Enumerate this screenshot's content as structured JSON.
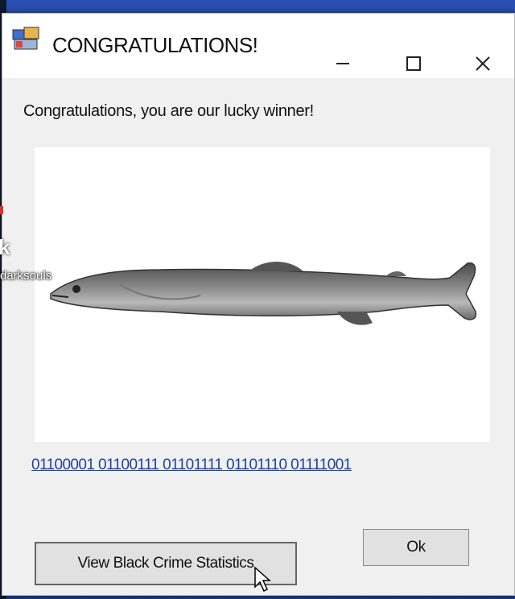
{
  "window": {
    "title": "CONGRATULATIONS!",
    "icons": {
      "app": "app-window-icon",
      "minimize": "minimize-icon",
      "maximize": "maximize-icon",
      "close": "close-icon"
    }
  },
  "dialog": {
    "message": "Congratulations, you are our lucky winner!",
    "picture": "fish-image",
    "link_text": "01100001 01100111 01101111 01101110 01111001",
    "ok_label": "Ok",
    "stats_label": "View Black Crime Statistics"
  },
  "overlay": {
    "letter": "k",
    "handle": "darksouls"
  },
  "colors": {
    "link": "#1b3fa6",
    "button_bg": "#e1e1e1",
    "window_bg": "#f0f0f0",
    "desktop": "#2447a3"
  }
}
